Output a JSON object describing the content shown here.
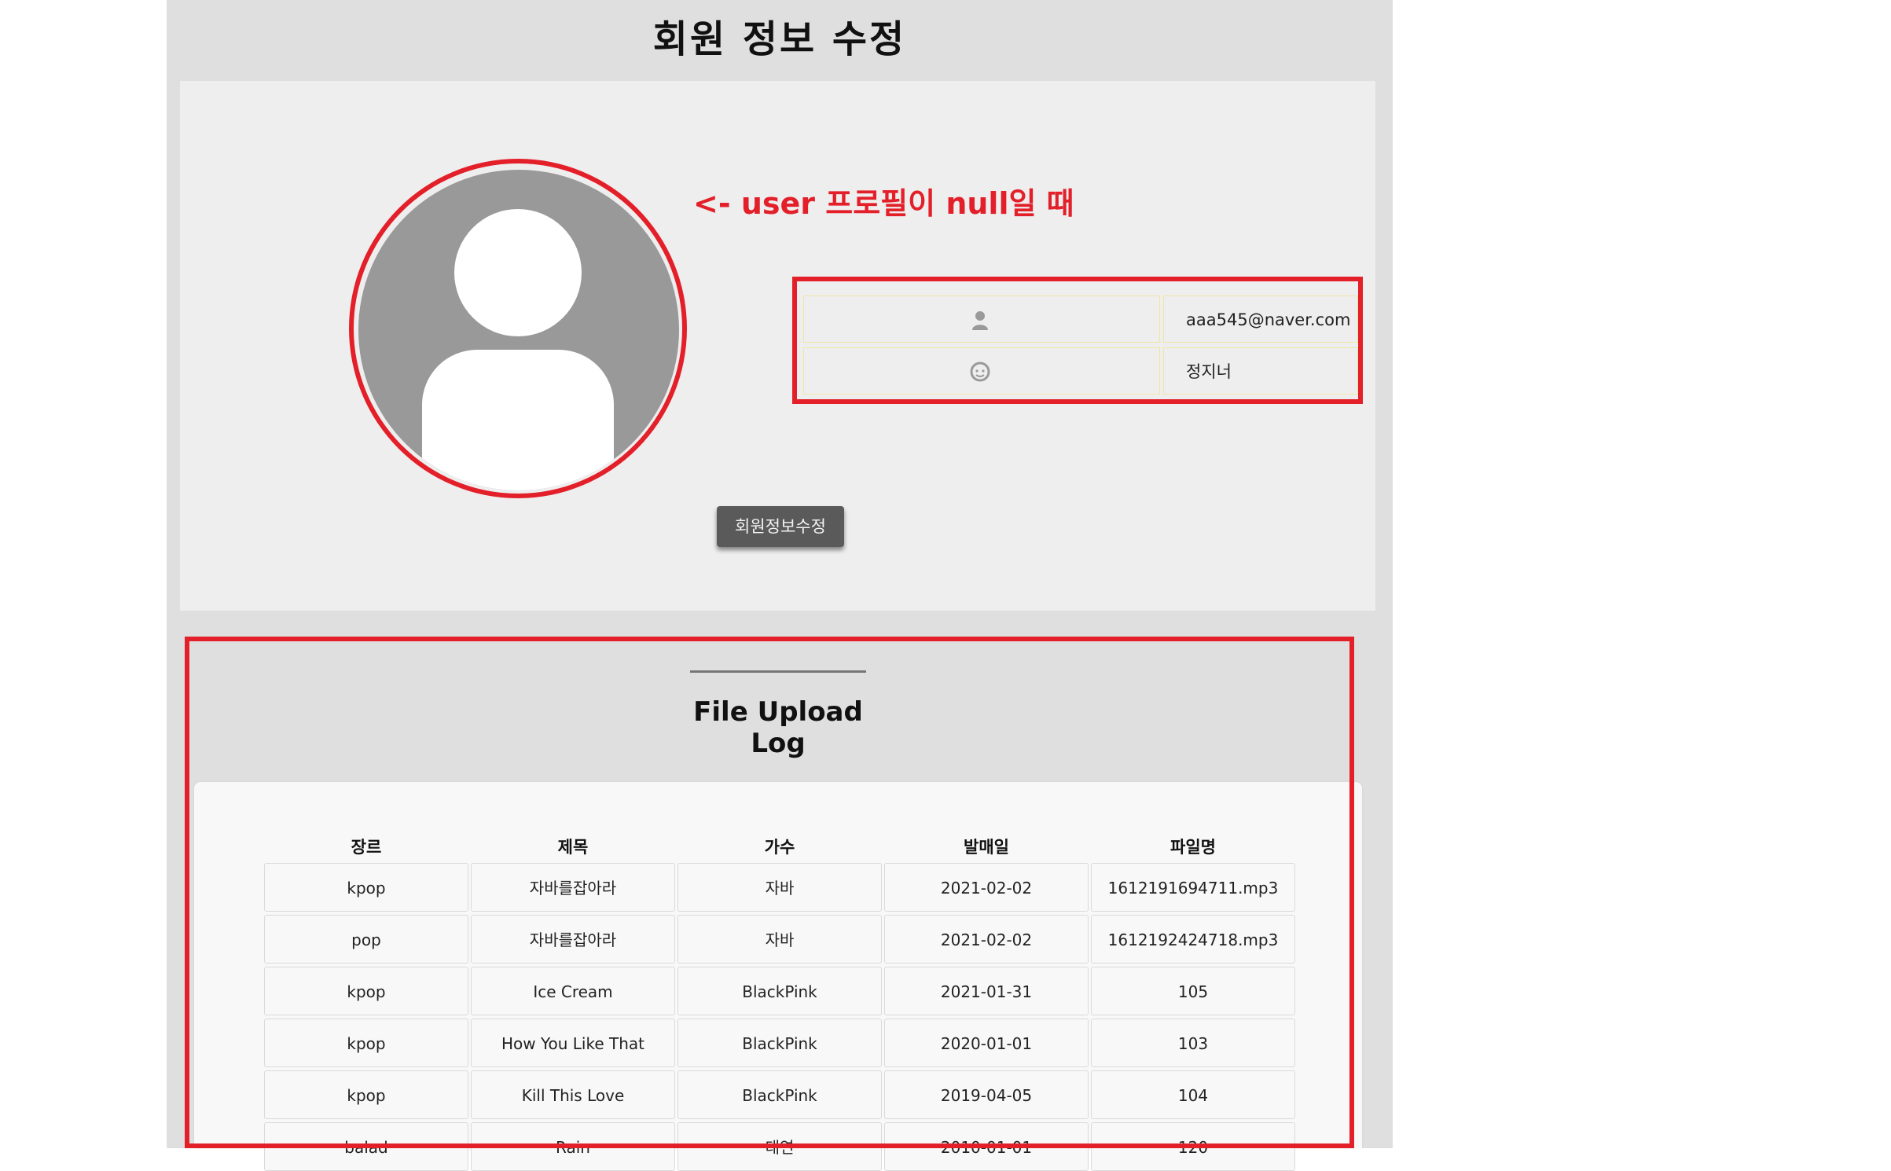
{
  "page": {
    "title": "회원 정보 수정"
  },
  "annotation": "<- user 프로필이 null일 때",
  "user": {
    "email": "aaa545@naver.com",
    "name": "정지너",
    "email_icon": "person-icon",
    "name_icon": "face-icon"
  },
  "edit_button": "회원정보수정",
  "log": {
    "title": "File Upload Log",
    "headers": [
      "장르",
      "제목",
      "가수",
      "발매일",
      "파일명"
    ],
    "rows": [
      [
        "kpop",
        "자바를잡아라",
        "자바",
        "2021-02-02",
        "1612191694711.mp3"
      ],
      [
        "pop",
        "자바를잡아라",
        "자바",
        "2021-02-02",
        "1612192424718.mp3"
      ],
      [
        "kpop",
        "Ice Cream",
        "BlackPink",
        "2021-01-31",
        "105"
      ],
      [
        "kpop",
        "How You Like That",
        "BlackPink",
        "2020-01-01",
        "103"
      ],
      [
        "kpop",
        "Kill This Love",
        "BlackPink",
        "2019-04-05",
        "104"
      ],
      [
        "balad",
        "Rain",
        "태연",
        "2010-01-01",
        "120"
      ]
    ]
  },
  "colors": {
    "annotation_red": "#e3202a",
    "outer_bg": "#e0dfdf",
    "panel_bg": "#efeeee",
    "avatar_grey": "#999999",
    "button_bg": "#5a5a5a"
  }
}
